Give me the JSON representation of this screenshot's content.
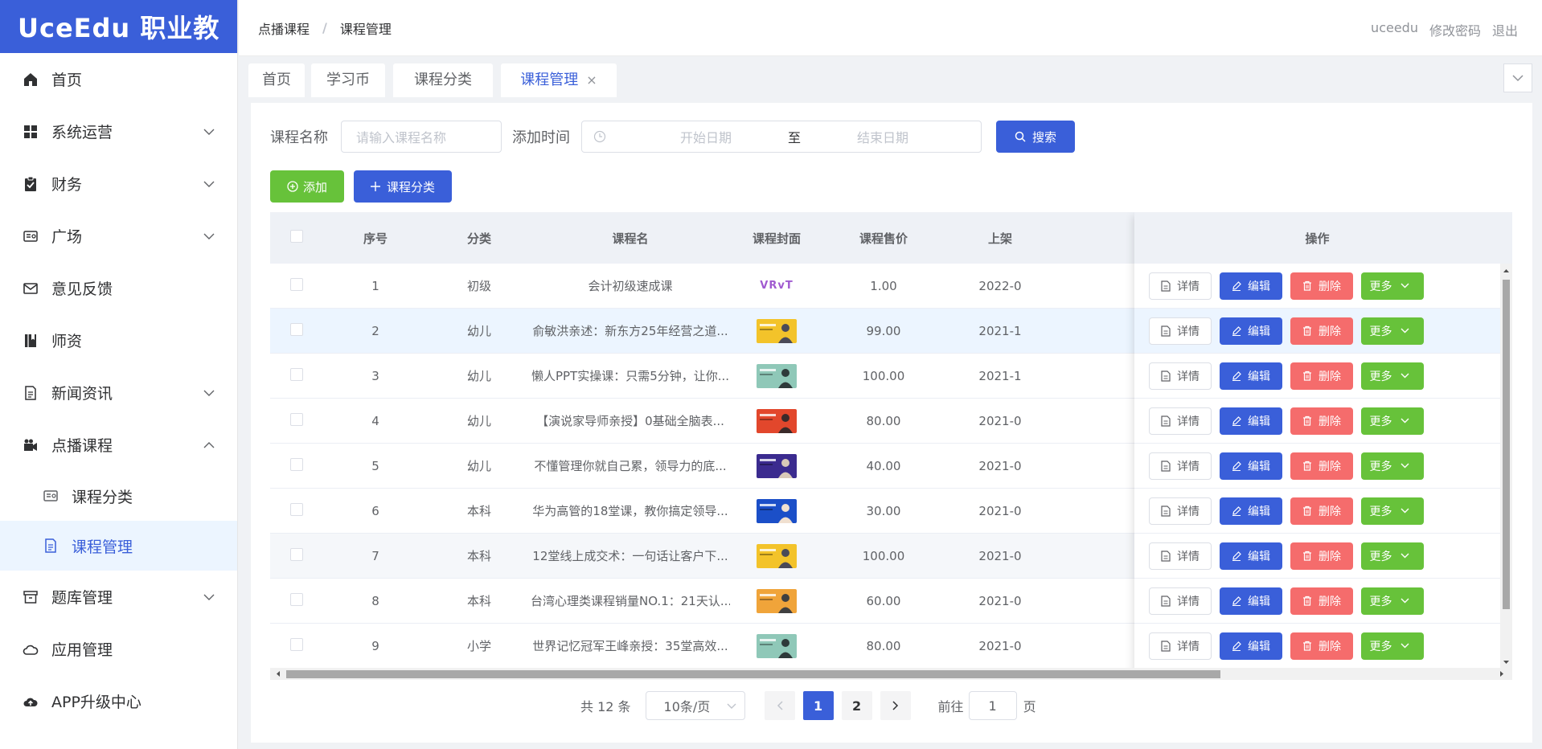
{
  "logo": "UceEdu 职业教育",
  "sidebar": {
    "items": [
      {
        "label": "首页",
        "icon": "home-icon",
        "expandable": false
      },
      {
        "label": "系统运营",
        "icon": "grid-icon",
        "expandable": true
      },
      {
        "label": "财务",
        "icon": "clipboard-icon",
        "expandable": true
      },
      {
        "label": "广场",
        "icon": "id-card-icon",
        "expandable": true
      },
      {
        "label": "意见反馈",
        "icon": "mail-icon",
        "expandable": false
      },
      {
        "label": "师资",
        "icon": "book-icon",
        "expandable": false
      },
      {
        "label": "新闻资讯",
        "icon": "document-icon",
        "expandable": true
      },
      {
        "label": "点播课程",
        "icon": "camera-icon",
        "expandable": true,
        "expanded": true
      },
      {
        "label": "课程分类",
        "icon": "id-card-icon",
        "sub": true
      },
      {
        "label": "课程管理",
        "icon": "document-icon",
        "sub": true,
        "active": true
      },
      {
        "label": "题库管理",
        "icon": "archive-icon",
        "expandable": true
      },
      {
        "label": "应用管理",
        "icon": "cloud-icon",
        "expandable": false
      },
      {
        "label": "APP升级中心",
        "icon": "upload-cloud-icon",
        "expandable": false
      }
    ]
  },
  "header": {
    "breadcrumb": [
      "点播课程",
      "课程管理"
    ],
    "user": "uceedu",
    "change_password": "修改密码",
    "logout": "退出"
  },
  "tabs": [
    {
      "label": "首页"
    },
    {
      "label": "学习币"
    },
    {
      "label": "课程分类"
    },
    {
      "label": "课程管理",
      "active": true,
      "close": "×"
    }
  ],
  "filter": {
    "name_label": "课程名称",
    "name_placeholder": "请输入课程名称",
    "time_label": "添加时间",
    "start_placeholder": "开始日期",
    "range_sep": "至",
    "end_placeholder": "结束日期",
    "search_label": "搜索"
  },
  "actions": {
    "add_label": "添加",
    "category_label": "课程分类"
  },
  "table": {
    "columns": [
      "序号",
      "分类",
      "课程名",
      "课程封面",
      "课程售价",
      "上架",
      "操作"
    ],
    "rows": [
      {
        "index": "1",
        "category": "初级",
        "name": "会计初级速成课",
        "cover": "logo",
        "price": "1.00",
        "date": "2022-0"
      },
      {
        "index": "2",
        "category": "幼儿",
        "name": "俞敏洪亲述：新东方25年经营之道...",
        "cover": "yellow",
        "price": "99.00",
        "date": "2021-1"
      },
      {
        "index": "3",
        "category": "幼儿",
        "name": "懒人PPT实操课：只需5分钟，让你...",
        "cover": "teal",
        "price": "100.00",
        "date": "2021-1"
      },
      {
        "index": "4",
        "category": "幼儿",
        "name": "【演说家导师亲授】0基础全脑表...",
        "cover": "red",
        "price": "80.00",
        "date": "2021-0"
      },
      {
        "index": "5",
        "category": "幼儿",
        "name": "不懂管理你就自己累，领导力的底...",
        "cover": "purple",
        "price": "40.00",
        "date": "2021-0"
      },
      {
        "index": "6",
        "category": "本科",
        "name": "华为高管的18堂课，教你搞定领导...",
        "cover": "blue",
        "price": "30.00",
        "date": "2021-0"
      },
      {
        "index": "7",
        "category": "本科",
        "name": "12堂线上成交术：一句话让客户下...",
        "cover": "yellow",
        "price": "100.00",
        "date": "2021-0"
      },
      {
        "index": "8",
        "category": "本科",
        "name": "台湾心理类课程销量NO.1：21天认...",
        "cover": "orange",
        "price": "60.00",
        "date": "2021-0"
      },
      {
        "index": "9",
        "category": "小学",
        "name": "世界记忆冠军王峰亲授：35堂高效...",
        "cover": "teal",
        "price": "80.00",
        "date": "2021-0"
      }
    ],
    "ops": {
      "detail": "详情",
      "edit": "编辑",
      "delete": "删除",
      "more": "更多"
    },
    "cover_logo_text": "VRvT"
  },
  "pagination": {
    "total": "共 12 条",
    "page_size": "10条/页",
    "pages": [
      "1",
      "2"
    ],
    "current": "1",
    "goto_label": "前往",
    "goto_value": "1",
    "page_suffix": "页"
  },
  "colors": {
    "primary": "#3a5fd9",
    "success": "#67c23a",
    "danger": "#f56c6c"
  }
}
